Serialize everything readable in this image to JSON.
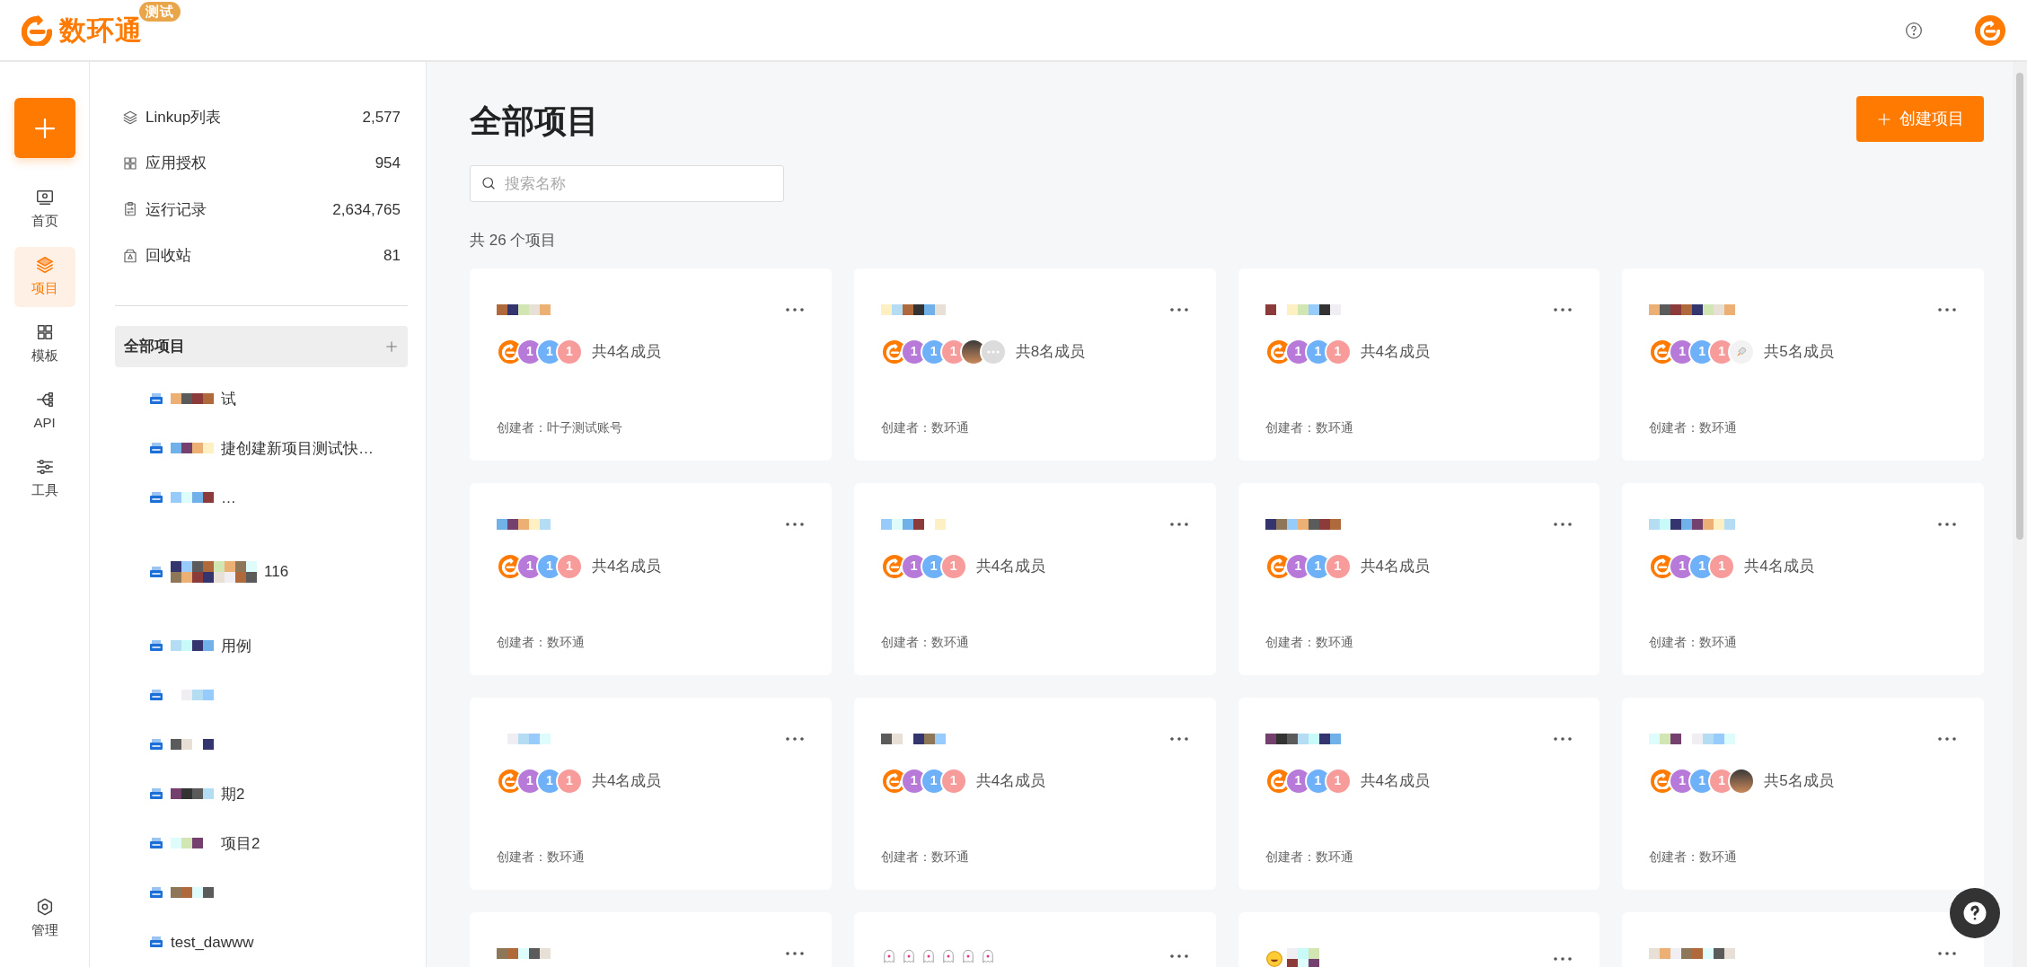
{
  "header": {
    "logo_text": "数环通",
    "badge": "测试"
  },
  "rail": {
    "items": [
      {
        "kind": "home",
        "label": "首页",
        "selected": false
      },
      {
        "kind": "projects",
        "label": "项目",
        "selected": true
      },
      {
        "kind": "templates",
        "label": "模板",
        "selected": false
      },
      {
        "kind": "api",
        "label": "API",
        "selected": false
      },
      {
        "kind": "tools",
        "label": "工具",
        "selected": false
      }
    ],
    "bottom": {
      "kind": "admin",
      "label": "管理",
      "selected": false
    }
  },
  "sidebar": {
    "stats": [
      {
        "kind": "layers",
        "label": "Linkup列表",
        "count": "2,577"
      },
      {
        "kind": "grid",
        "label": "应用授权",
        "count": "954"
      },
      {
        "kind": "clipboard",
        "label": "运行记录",
        "count": "2,634,765"
      },
      {
        "kind": "trash",
        "label": "回收站",
        "count": "81"
      }
    ],
    "tree": {
      "label": "全部项目",
      "selected": true,
      "items": [
        {
          "redacted": true,
          "text": "试"
        },
        {
          "redacted": true,
          "text": "捷创建新项目测试快…"
        },
        {
          "redacted": true,
          "text": "…"
        },
        {
          "redacted": true,
          "text": "116",
          "wrapped": true
        },
        {
          "redacted": true,
          "text": "用例"
        },
        {
          "redacted": true
        },
        {
          "redacted": true
        },
        {
          "redacted": true,
          "text": "期2"
        },
        {
          "redacted": true,
          "text": "项目2"
        },
        {
          "redacted": true
        },
        {
          "redacted": false,
          "text": "test_dawww"
        }
      ]
    }
  },
  "main": {
    "title": "全部项目",
    "create_button": "创建项目",
    "search": {
      "placeholder": "搜索名称"
    },
    "count_text": "共 26 个项目",
    "cards": [
      {
        "kind": "mosaic",
        "members": [
          {
            "kind": "logo"
          },
          {
            "kind": "initial",
            "text": "1",
            "color": "#b77ad9"
          },
          {
            "kind": "initial",
            "text": "1",
            "color": "#6fb1f8"
          },
          {
            "kind": "initial",
            "text": "1",
            "color": "#f79b9b"
          }
        ],
        "member_text": "共4名成员",
        "creator": "创建者：叶子测试账号"
      },
      {
        "kind": "mosaic",
        "members": [
          {
            "kind": "logo"
          },
          {
            "kind": "initial",
            "text": "1",
            "color": "#b77ad9"
          },
          {
            "kind": "initial",
            "text": "1",
            "color": "#6fb1f8"
          },
          {
            "kind": "initial",
            "text": "1",
            "color": "#f79b9b"
          },
          {
            "kind": "photo"
          },
          {
            "kind": "more"
          }
        ],
        "member_text": "共8名成员",
        "creator": "创建者：数环通"
      },
      {
        "kind": "mosaic",
        "members": [
          {
            "kind": "logo"
          },
          {
            "kind": "initial",
            "text": "1",
            "color": "#b77ad9"
          },
          {
            "kind": "initial",
            "text": "1",
            "color": "#6fb1f8"
          },
          {
            "kind": "initial",
            "text": "1",
            "color": "#f79b9b"
          }
        ],
        "member_text": "共4名成员",
        "creator": "创建者：数环通"
      },
      {
        "kind": "mosaic",
        "members": [
          {
            "kind": "logo"
          },
          {
            "kind": "initial",
            "text": "1",
            "color": "#b77ad9"
          },
          {
            "kind": "initial",
            "text": "1",
            "color": "#6fb1f8"
          },
          {
            "kind": "initial",
            "text": "1",
            "color": "#f79b9b"
          },
          {
            "kind": "rocket"
          }
        ],
        "member_text": "共5名成员",
        "creator": "创建者：数环通"
      },
      {
        "kind": "mosaic",
        "members": [
          {
            "kind": "logo"
          },
          {
            "kind": "initial",
            "text": "1",
            "color": "#b77ad9"
          },
          {
            "kind": "initial",
            "text": "1",
            "color": "#6fb1f8"
          },
          {
            "kind": "initial",
            "text": "1",
            "color": "#f79b9b"
          }
        ],
        "member_text": "共4名成员",
        "creator": "创建者：数环通"
      },
      {
        "kind": "mosaic",
        "members": [
          {
            "kind": "logo"
          },
          {
            "kind": "initial",
            "text": "1",
            "color": "#b77ad9"
          },
          {
            "kind": "initial",
            "text": "1",
            "color": "#6fb1f8"
          },
          {
            "kind": "initial",
            "text": "1",
            "color": "#f79b9b"
          }
        ],
        "member_text": "共4名成员",
        "creator": "创建者：数环通"
      },
      {
        "kind": "mosaic",
        "members": [
          {
            "kind": "logo"
          },
          {
            "kind": "initial",
            "text": "1",
            "color": "#b77ad9"
          },
          {
            "kind": "initial",
            "text": "1",
            "color": "#6fb1f8"
          },
          {
            "kind": "initial",
            "text": "1",
            "color": "#f79b9b"
          }
        ],
        "member_text": "共4名成员",
        "creator": "创建者：数环通"
      },
      {
        "kind": "mosaic",
        "members": [
          {
            "kind": "logo"
          },
          {
            "kind": "initial",
            "text": "1",
            "color": "#b77ad9"
          },
          {
            "kind": "initial",
            "text": "1",
            "color": "#6fb1f8"
          },
          {
            "kind": "initial",
            "text": "1",
            "color": "#f79b9b"
          }
        ],
        "member_text": "共4名成员",
        "creator": "创建者：数环通"
      },
      {
        "kind": "mosaic",
        "members": [
          {
            "kind": "logo"
          },
          {
            "kind": "initial",
            "text": "1",
            "color": "#b77ad9"
          },
          {
            "kind": "initial",
            "text": "1",
            "color": "#6fb1f8"
          },
          {
            "kind": "initial",
            "text": "1",
            "color": "#f79b9b"
          }
        ],
        "member_text": "共4名成员",
        "creator": "创建者：数环通"
      },
      {
        "kind": "mosaic",
        "members": [
          {
            "kind": "logo"
          },
          {
            "kind": "initial",
            "text": "1",
            "color": "#b77ad9"
          },
          {
            "kind": "initial",
            "text": "1",
            "color": "#6fb1f8"
          },
          {
            "kind": "initial",
            "text": "1",
            "color": "#f79b9b"
          }
        ],
        "member_text": "共4名成员",
        "creator": "创建者：数环通"
      },
      {
        "kind": "mosaic",
        "members": [
          {
            "kind": "logo"
          },
          {
            "kind": "initial",
            "text": "1",
            "color": "#b77ad9"
          },
          {
            "kind": "initial",
            "text": "1",
            "color": "#6fb1f8"
          },
          {
            "kind": "initial",
            "text": "1",
            "color": "#f79b9b"
          }
        ],
        "member_text": "共4名成员",
        "creator": "创建者：数环通"
      },
      {
        "kind": "mosaic",
        "members": [
          {
            "kind": "logo"
          },
          {
            "kind": "initial",
            "text": "1",
            "color": "#b77ad9"
          },
          {
            "kind": "initial",
            "text": "1",
            "color": "#6fb1f8"
          },
          {
            "kind": "initial",
            "text": "1",
            "color": "#f79b9b"
          },
          {
            "kind": "photo"
          }
        ],
        "member_text": "共5名成员",
        "creator": "创建者：数环通"
      },
      {
        "kind": "mosaic"
      },
      {
        "kind": "ghosts"
      },
      {
        "kind": "smiley"
      },
      {
        "kind": "mosaic"
      }
    ]
  }
}
